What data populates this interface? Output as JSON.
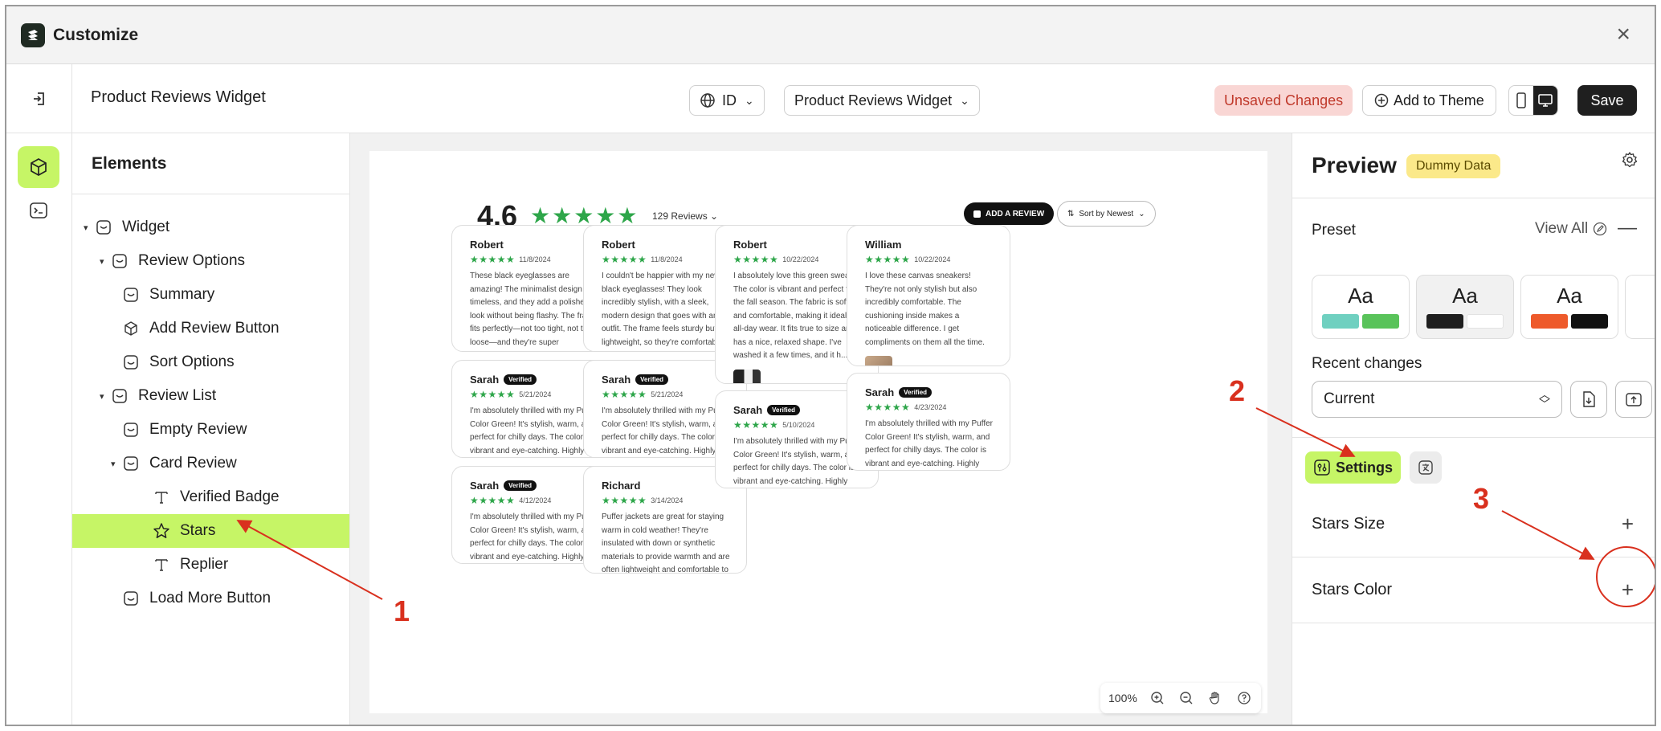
{
  "window": {
    "title": "Customize",
    "close": "×"
  },
  "toolbar": {
    "page_name": "Product Reviews Widget",
    "language": "ID",
    "widget_select": "Product Reviews Widget",
    "unsaved": "Unsaved Changes",
    "add_to_theme": "Add to Theme",
    "save": "Save"
  },
  "elements": {
    "heading": "Elements",
    "tree": [
      {
        "label": "Widget"
      },
      {
        "label": "Review Options"
      },
      {
        "label": "Summary"
      },
      {
        "label": "Add Review Button"
      },
      {
        "label": "Sort Options"
      },
      {
        "label": "Review List"
      },
      {
        "label": "Empty Review"
      },
      {
        "label": "Card Review"
      },
      {
        "label": "Verified Badge"
      },
      {
        "label": "Stars"
      },
      {
        "label": "Replier"
      },
      {
        "label": "Load More Button"
      }
    ]
  },
  "widget": {
    "rating": "4.6",
    "stars": "★★★★★",
    "reviews_count": "129 Reviews",
    "add_review": "ADD A REVIEW",
    "sort": "Sort by Newest",
    "cards": [
      {
        "name": "Robert",
        "verified": "",
        "stars": "★★★★★",
        "date": "11/8/2024",
        "text": "These black eyeglasses are amazing! The minimalist design is timeless, and they add a polished look without being flashy. The frame fits perfectly—not too tight, not too loose—and they're super comfortable, even after wearing them for hours. The qual..."
      },
      {
        "name": "Sarah",
        "verified": "Verified",
        "stars": "★★★★★",
        "date": "5/21/2024",
        "text": "I'm absolutely thrilled with my Puffer Color Green! It's stylish, warm, and perfect for chilly days. The color is vibrant and eye-catching. Highly recommend!"
      },
      {
        "name": "Sarah",
        "verified": "Verified",
        "stars": "★★★★★",
        "date": "4/12/2024",
        "text": "I'm absolutely thrilled with my Puffer Color Green! It's stylish, warm, and perfect for chilly days. The color is vibrant and eye-catching. Highly recommend!"
      },
      {
        "name": "Robert",
        "verified": "",
        "stars": "★★★★★",
        "date": "11/8/2024",
        "text": "I couldn't be happier with my new black eyeglasses! They look incredibly stylish, with a sleek, modern design that goes with any outfit. The frame feels sturdy but lightweight, so they're comfortable to wear all day. The lenses offer clear vision wit..."
      },
      {
        "name": "Sarah",
        "verified": "Verified",
        "stars": "★★★★★",
        "date": "5/21/2024",
        "text": "I'm absolutely thrilled with my Puffer Color Green! It's stylish, warm, and perfect for chilly days. The color is vibrant and eye-catching. Highly recommend!"
      },
      {
        "name": "Richard",
        "verified": "",
        "stars": "★★★★★",
        "date": "3/14/2024",
        "text": "Puffer jackets are great for staying warm in cold weather! They're insulated with down or synthetic materials to provide warmth and are often lightweight and comfortable to wear"
      },
      {
        "name": "Robert",
        "verified": "",
        "stars": "★★★★★",
        "date": "10/22/2024",
        "text": "I absolutely love this green sweater! The color is vibrant and perfect for the fall season. The fabric is soft and comfortable, making it ideal for all-day wear. It fits true to size and has a nice, relaxed shape. I've washed it a few times, and it h..."
      },
      {
        "name": "Sarah",
        "verified": "Verified",
        "stars": "★★★★★",
        "date": "5/10/2024",
        "text": "I'm absolutely thrilled with my Puffer Color Green! It's stylish, warm, and perfect for chilly days. The color is vibrant and eye-catching. Highly recommend!"
      },
      {
        "name": "William",
        "verified": "",
        "stars": "★★★★★",
        "date": "10/22/2024",
        "text": "I love these canvas sneakers! They're not only stylish but also incredibly comfortable. The cushioning inside makes a noticeable difference. I get compliments on them all the time."
      },
      {
        "name": "Sarah",
        "verified": "Verified",
        "stars": "★★★★★",
        "date": "4/23/2024",
        "text": "I'm absolutely thrilled with my Puffer Color Green! It's stylish, warm, and perfect for chilly days. The color is vibrant and eye-catching. Highly recommend!"
      }
    ],
    "zoom": "100%"
  },
  "preview": {
    "title": "Preview",
    "badge": "Dummy Data",
    "preset_label": "Preset",
    "view_all": "View All",
    "preset_sample": "Aa",
    "recent_label": "Recent changes",
    "recent_value": "Current",
    "settings_tab": "Settings",
    "rows": [
      {
        "label": "Stars Size"
      },
      {
        "label": "Stars Color"
      }
    ]
  },
  "annotations": {
    "one": "1",
    "two": "2",
    "three": "3"
  },
  "colors": {
    "accent": "#c6f566",
    "star": "#2ea64a",
    "annotation": "#d9301e",
    "dummy_badge": "#fbe98a",
    "unsaved_bg": "#f9d6d4"
  }
}
